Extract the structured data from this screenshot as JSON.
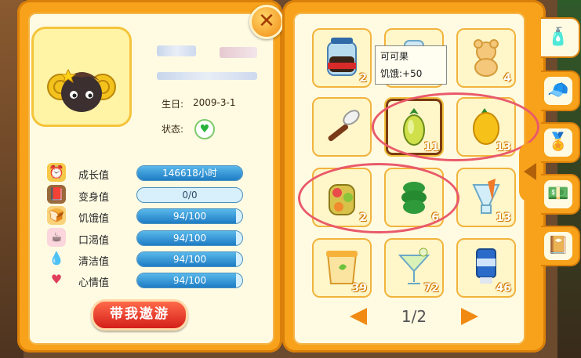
{
  "profile": {
    "birthday_label": "生日:",
    "birthday_value": "2009-3-1",
    "status_label": "状态:",
    "status_icon": "heart-icon",
    "take_button": "带我遨游"
  },
  "stats": [
    {
      "label": "成长值",
      "value": "146618小时",
      "fraction": 1.0,
      "icon": "clock-icon"
    },
    {
      "label": "变身值",
      "value": "0/0",
      "fraction": 0.0,
      "icon": "book-icon"
    },
    {
      "label": "饥饿值",
      "value": "94/100",
      "fraction": 0.94,
      "icon": "bread-icon"
    },
    {
      "label": "口渴值",
      "value": "94/100",
      "fraction": 0.94,
      "icon": "cup-icon"
    },
    {
      "label": "清洁值",
      "value": "94/100",
      "fraction": 0.94,
      "icon": "water-drop-icon"
    },
    {
      "label": "心情值",
      "value": "94/100",
      "fraction": 0.94,
      "icon": "heart-note-icon"
    }
  ],
  "inventory": {
    "items": [
      {
        "icon": "jar-icon",
        "count": "2"
      },
      {
        "icon": "bottle-icon",
        "count": ""
      },
      {
        "icon": "bear-cookie-icon",
        "count": "4"
      },
      {
        "icon": "brush-icon",
        "count": ""
      },
      {
        "icon": "cocoa-fruit-icon",
        "count": "11"
      },
      {
        "icon": "mango-icon",
        "count": "13"
      },
      {
        "icon": "flower-cake-icon",
        "count": "2"
      },
      {
        "icon": "cactus-icon",
        "count": "6"
      },
      {
        "icon": "carrot-drink-icon",
        "count": "13"
      },
      {
        "icon": "yogurt-icon",
        "count": "39"
      },
      {
        "icon": "cocktail-icon",
        "count": "72"
      },
      {
        "icon": "tube-icon",
        "count": "46"
      }
    ],
    "tooltip": {
      "name": "可可果",
      "effect": "饥饿:+50"
    },
    "page": "1/2"
  },
  "colors": {
    "panel": "#f7a21a",
    "bar": "#1e7cc4",
    "highlight": "#e95a6a"
  }
}
